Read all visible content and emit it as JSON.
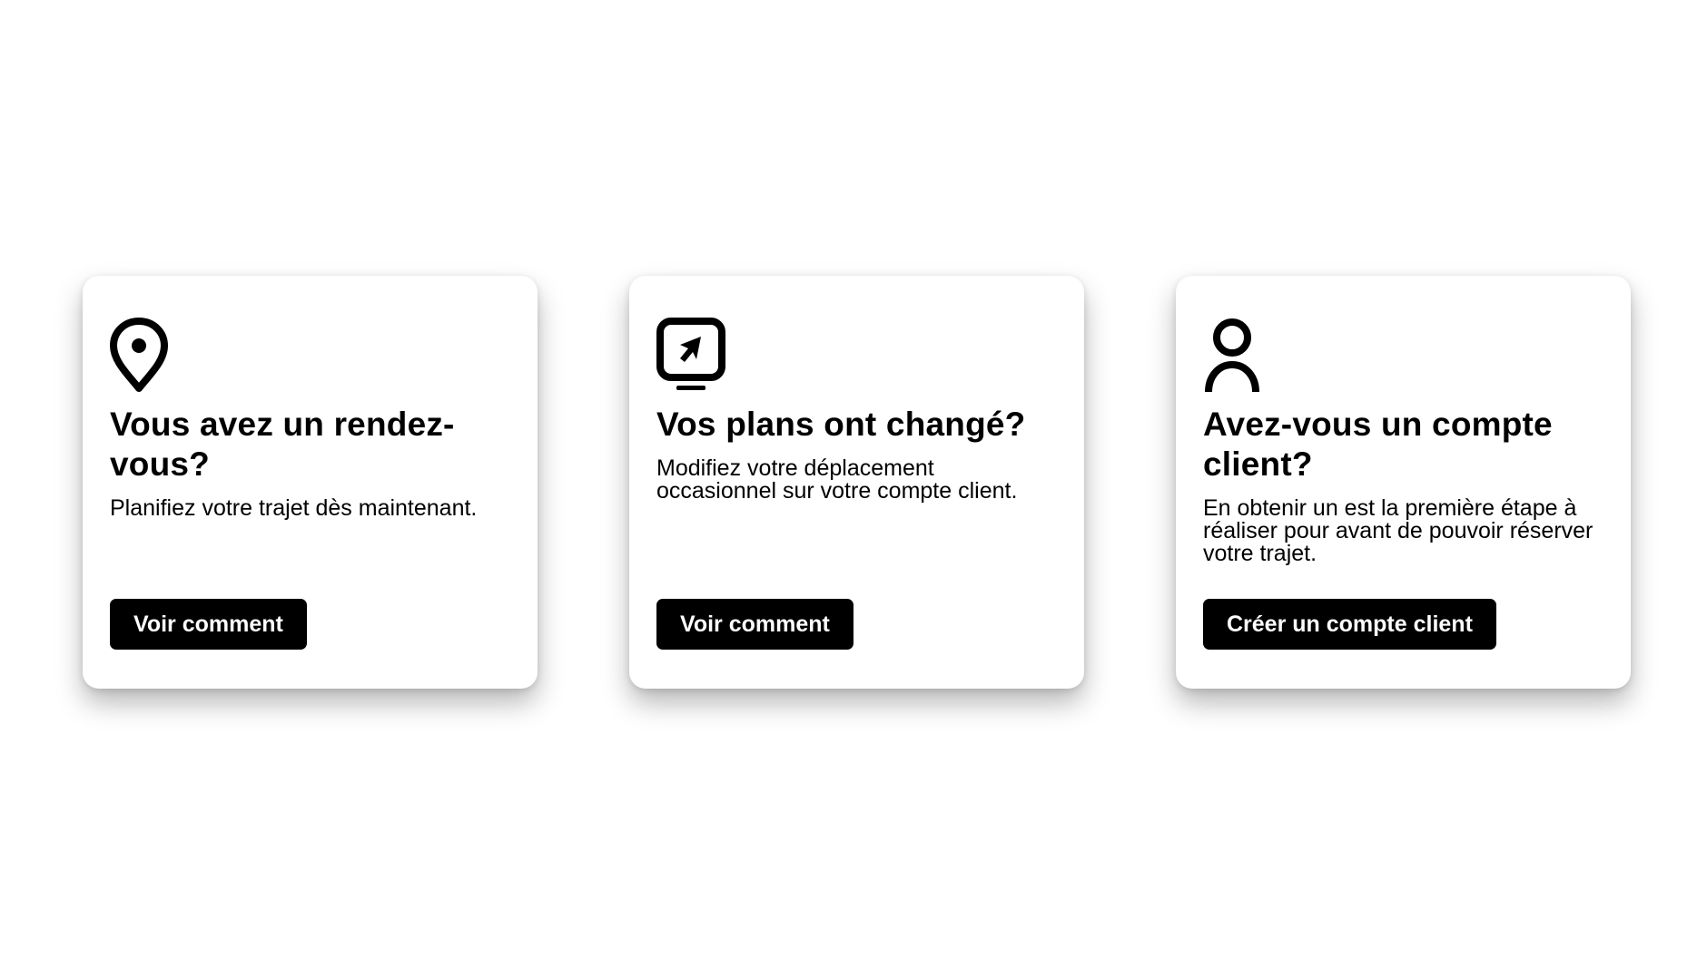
{
  "cards": [
    {
      "icon": "map-pin-icon",
      "title": "Vous avez un rendez-vous?",
      "text": "Planifiez votre trajet dès maintenant.",
      "button_label": "Voir comment"
    },
    {
      "icon": "screen-cursor-icon",
      "title": "Vos plans ont changé?",
      "text": "Modifiez votre déplacement occasionnel sur votre compte client.",
      "button_label": "Voir comment"
    },
    {
      "icon": "user-icon",
      "title": "Avez-vous un compte client?",
      "text": "En obtenir un est la première étape à réaliser pour avant de pouvoir réserver votre trajet.",
      "button_label": "Créer un compte client"
    }
  ],
  "colors": {
    "background": "#ffffff",
    "card": "#ffffff",
    "text": "#000000",
    "button_bg": "#000000",
    "button_text": "#ffffff"
  }
}
